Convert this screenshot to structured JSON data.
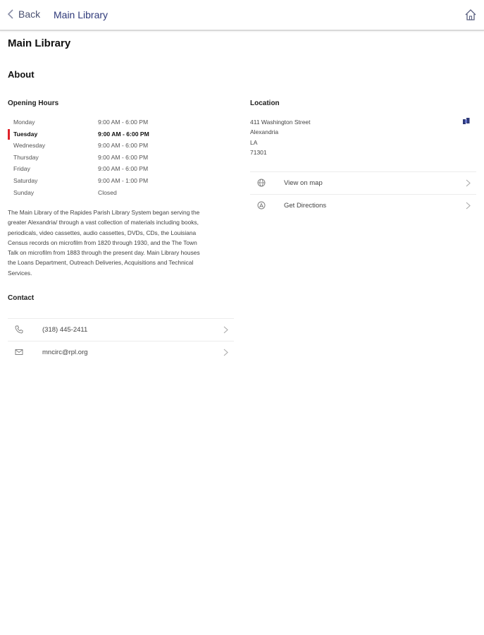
{
  "nav": {
    "back_label": "Back",
    "title": "Main Library"
  },
  "page_title": "Main Library",
  "about_title": "About",
  "opening_hours": {
    "heading": "Opening Hours",
    "rows": [
      {
        "day": "Monday",
        "time": "9:00 AM - 6:00 PM"
      },
      {
        "day": "Tuesday",
        "time": "9:00 AM - 6:00 PM",
        "today": true
      },
      {
        "day": "Wednesday",
        "time": "9:00 AM - 6:00 PM"
      },
      {
        "day": "Thursday",
        "time": "9:00 AM - 6:00 PM"
      },
      {
        "day": "Friday",
        "time": "9:00 AM - 6:00 PM"
      },
      {
        "day": "Saturday",
        "time": "9:00 AM - 1:00 PM"
      },
      {
        "day": "Sunday",
        "time": "Closed"
      }
    ]
  },
  "description_lines": [
    "The Main Library of the Rapides Parish Library System began serving the",
    "greater Alexandria/ through a vast collection of materials including books,",
    "periodicals, video cassettes, audio cassettes, DVDs, CDs, the Louisiana",
    "Census records on microfilm from 1820 through 1930, and the The Town",
    "Talk on microfilm from 1883 through the present day. Main Library houses",
    "the Loans Department, Outreach Deliveries, Acquisitions and Technical",
    "Services."
  ],
  "contact": {
    "heading": "Contact",
    "phone": "(318) 445-2411",
    "email": "mncirc@rpl.org"
  },
  "location": {
    "heading": "Location",
    "address_lines": [
      "411 Washington Street",
      "Alexandria",
      "LA",
      "71301"
    ],
    "view_on_map_label": "View on map",
    "directions_label": "Get Directions"
  },
  "colors": {
    "accent": "#2f3a7a",
    "today_marker": "#e0222a"
  }
}
